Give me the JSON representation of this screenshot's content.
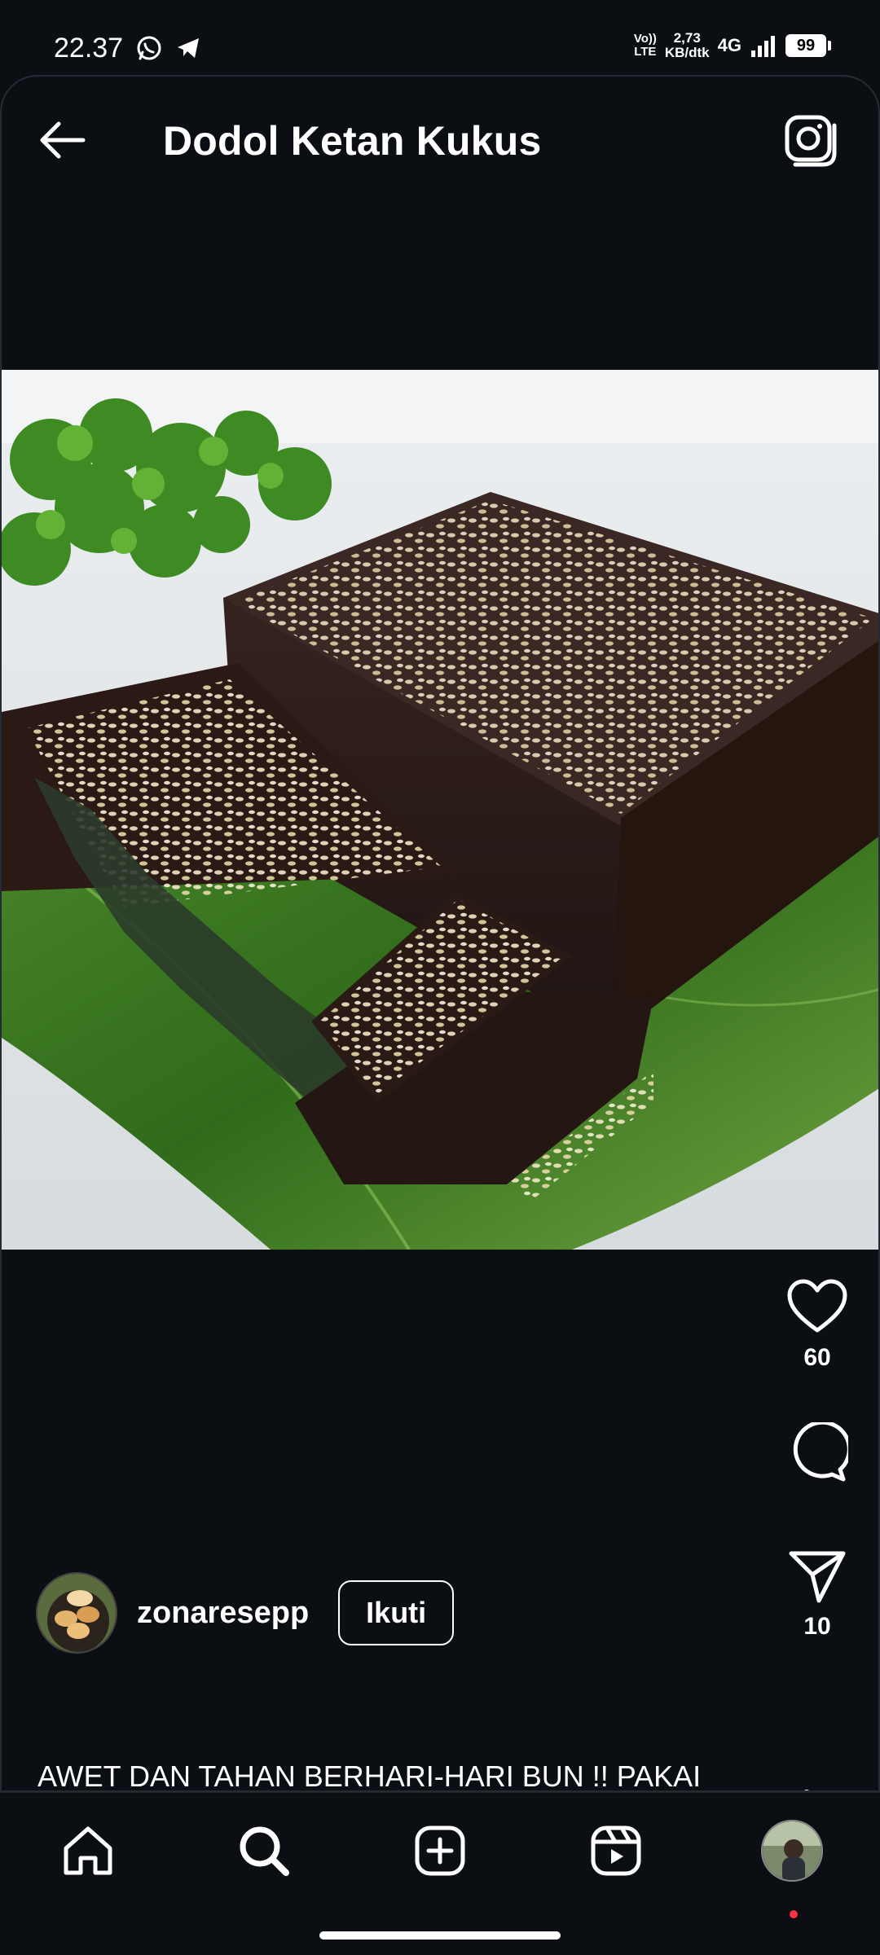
{
  "status_bar": {
    "time": "22.37",
    "volte_top": "Vo))",
    "volte_bottom": "LTE",
    "speed_top": "2,73",
    "speed_bottom": "KB/dtk",
    "network": "4G",
    "battery": "99",
    "notification_icons": [
      "whatsapp-icon",
      "telegram-icon"
    ]
  },
  "header": {
    "title": "Dodol Ketan Kukus",
    "back_icon": "arrow-left-icon",
    "camera_icon": "camera-icon"
  },
  "post": {
    "media_icon": "photo-dodol-ketan",
    "likes": "60",
    "shares": "10",
    "username": "zonaresepp",
    "follow_label": "Ikuti",
    "caption": "AWET DAN TAHAN BERHARI-HARI BUN !! PAKAI RESEP INI AJA ENAK DAN MUDAH BIKINNYA ..."
  },
  "bottom_nav": {
    "items": [
      "home-icon",
      "search-icon",
      "create-icon",
      "reels-icon",
      "profile-avatar"
    ]
  },
  "colors": {
    "background": "#0b0f14",
    "text": "#ffffff",
    "notification_dot": "#ff3040"
  }
}
